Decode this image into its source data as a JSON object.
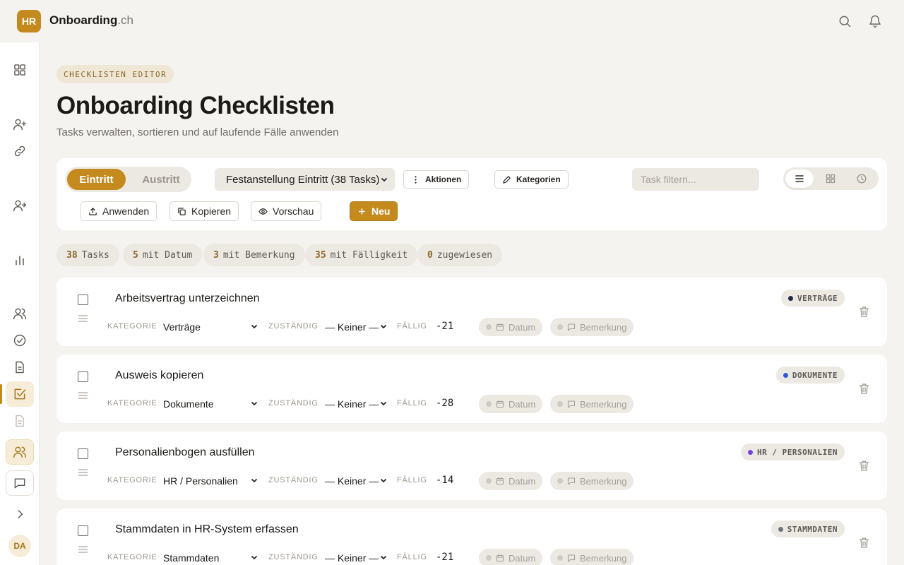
{
  "app": {
    "logo": "HR",
    "brand_bold": "Onboarding",
    "brand_suffix": ".ch"
  },
  "header": {
    "eyebrow": "CHECKLISTEN EDITOR",
    "title": "Onboarding Checklisten",
    "subtitle": "Tasks verwalten, sortieren und auf laufende Fälle anwenden"
  },
  "toolbar": {
    "seg_on": "Eintritt",
    "seg_off": "Austritt",
    "template": "Festanstellung Eintritt (38 Tasks)",
    "actions": "Aktionen",
    "categories": "Kategorien",
    "filter_placeholder": "Task filtern...",
    "apply": "Anwenden",
    "copy": "Kopieren",
    "preview": "Vorschau",
    "new": "Neu"
  },
  "stats": [
    {
      "num": "38",
      "label": "Tasks"
    },
    {
      "num": "5",
      "label": "mit Datum"
    },
    {
      "num": "3",
      "label": "mit Bemerkung"
    },
    {
      "num": "35",
      "label": "mit Fälligkeit"
    },
    {
      "num": "0",
      "label": "zugewiesen"
    }
  ],
  "labels": {
    "category": "KATEGORIE",
    "assignee": "ZUSTÄNDIG",
    "due": "FÄLLIG",
    "date": "Datum",
    "remark": "Bemerkung"
  },
  "tasks": [
    {
      "name": "Arbeitsvertrag unterzeichnen",
      "category": "Verträge",
      "assignee": "— Keiner —",
      "due": "-21",
      "badge": "VERTRÄGE",
      "badge_color": "#1f2a44"
    },
    {
      "name": "Ausweis kopieren",
      "category": "Dokumente",
      "assignee": "— Keiner —",
      "due": "-28",
      "badge": "DOKUMENTE",
      "badge_color": "#2f5bd3"
    },
    {
      "name": "Personalienbogen ausfüllen",
      "category": "HR / Personalien",
      "assignee": "— Keiner —",
      "due": "-14",
      "badge": "HR / PERSONALIEN",
      "badge_color": "#7b3fe0"
    },
    {
      "name": "Stammdaten in HR-System erfassen",
      "category": "Stammdaten",
      "assignee": "— Keiner —",
      "due": "-21",
      "badge": "STAMMDATEN",
      "badge_color": "#6b7280"
    }
  ],
  "user": {
    "initials": "DA"
  },
  "colors": {
    "accent": "#c48a1e",
    "background": "#f5f3f0"
  }
}
